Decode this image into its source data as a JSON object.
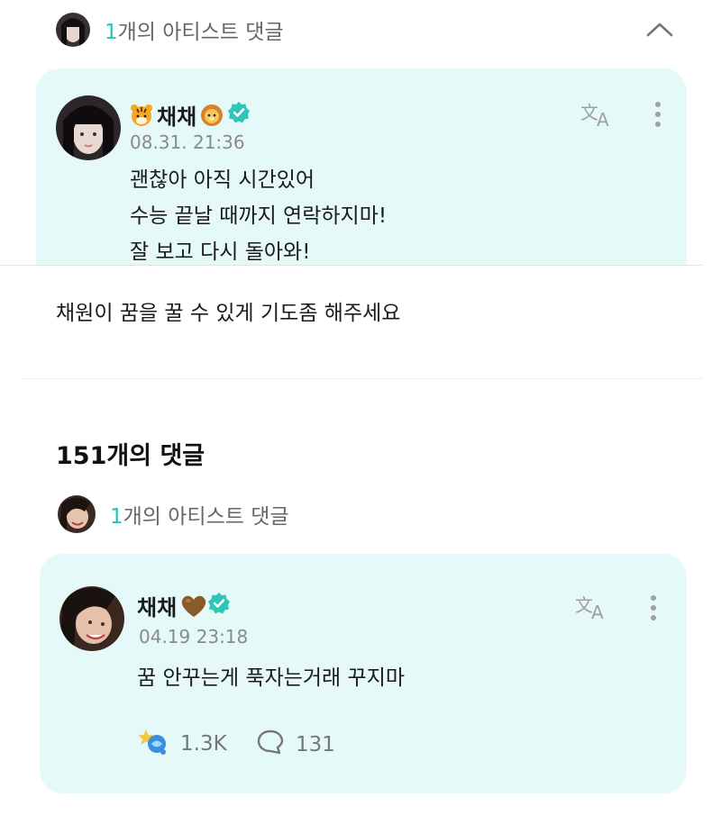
{
  "top_header": {
    "count": "1",
    "label": "개의 아티스트 댓글"
  },
  "top_comment": {
    "author": "채채",
    "timestamp": "08.31. 21:36",
    "lines": [
      "괜찮아 아직 시간있어",
      "수능 끝날 때까지 연락하지마!",
      "잘 보고 다시 돌아와!"
    ]
  },
  "post": {
    "text": "채원이 꿈을 꿀 수 있게 기도좀 해주세요"
  },
  "comments_section": {
    "title": "151개의 댓글"
  },
  "second_header": {
    "count": "1",
    "label": "개의 아티스트 댓글"
  },
  "second_comment": {
    "author": "채채",
    "timestamp": "04.19 23:18",
    "text": "꿈 안꾸는게 푹자는거래 꾸지마",
    "likes": "1.3K",
    "replies": "131"
  },
  "icons": {
    "collapse": "chevron-up-icon",
    "translate": "translate-icon",
    "more": "more-vertical-icon",
    "verified": "verified-badge-icon",
    "like": "like-reaction-icon",
    "reply": "reply-bubble-icon"
  },
  "colors": {
    "accent": "#2bc1b5",
    "card_bg": "#e5faf8",
    "verified": "#2fc6b8"
  }
}
